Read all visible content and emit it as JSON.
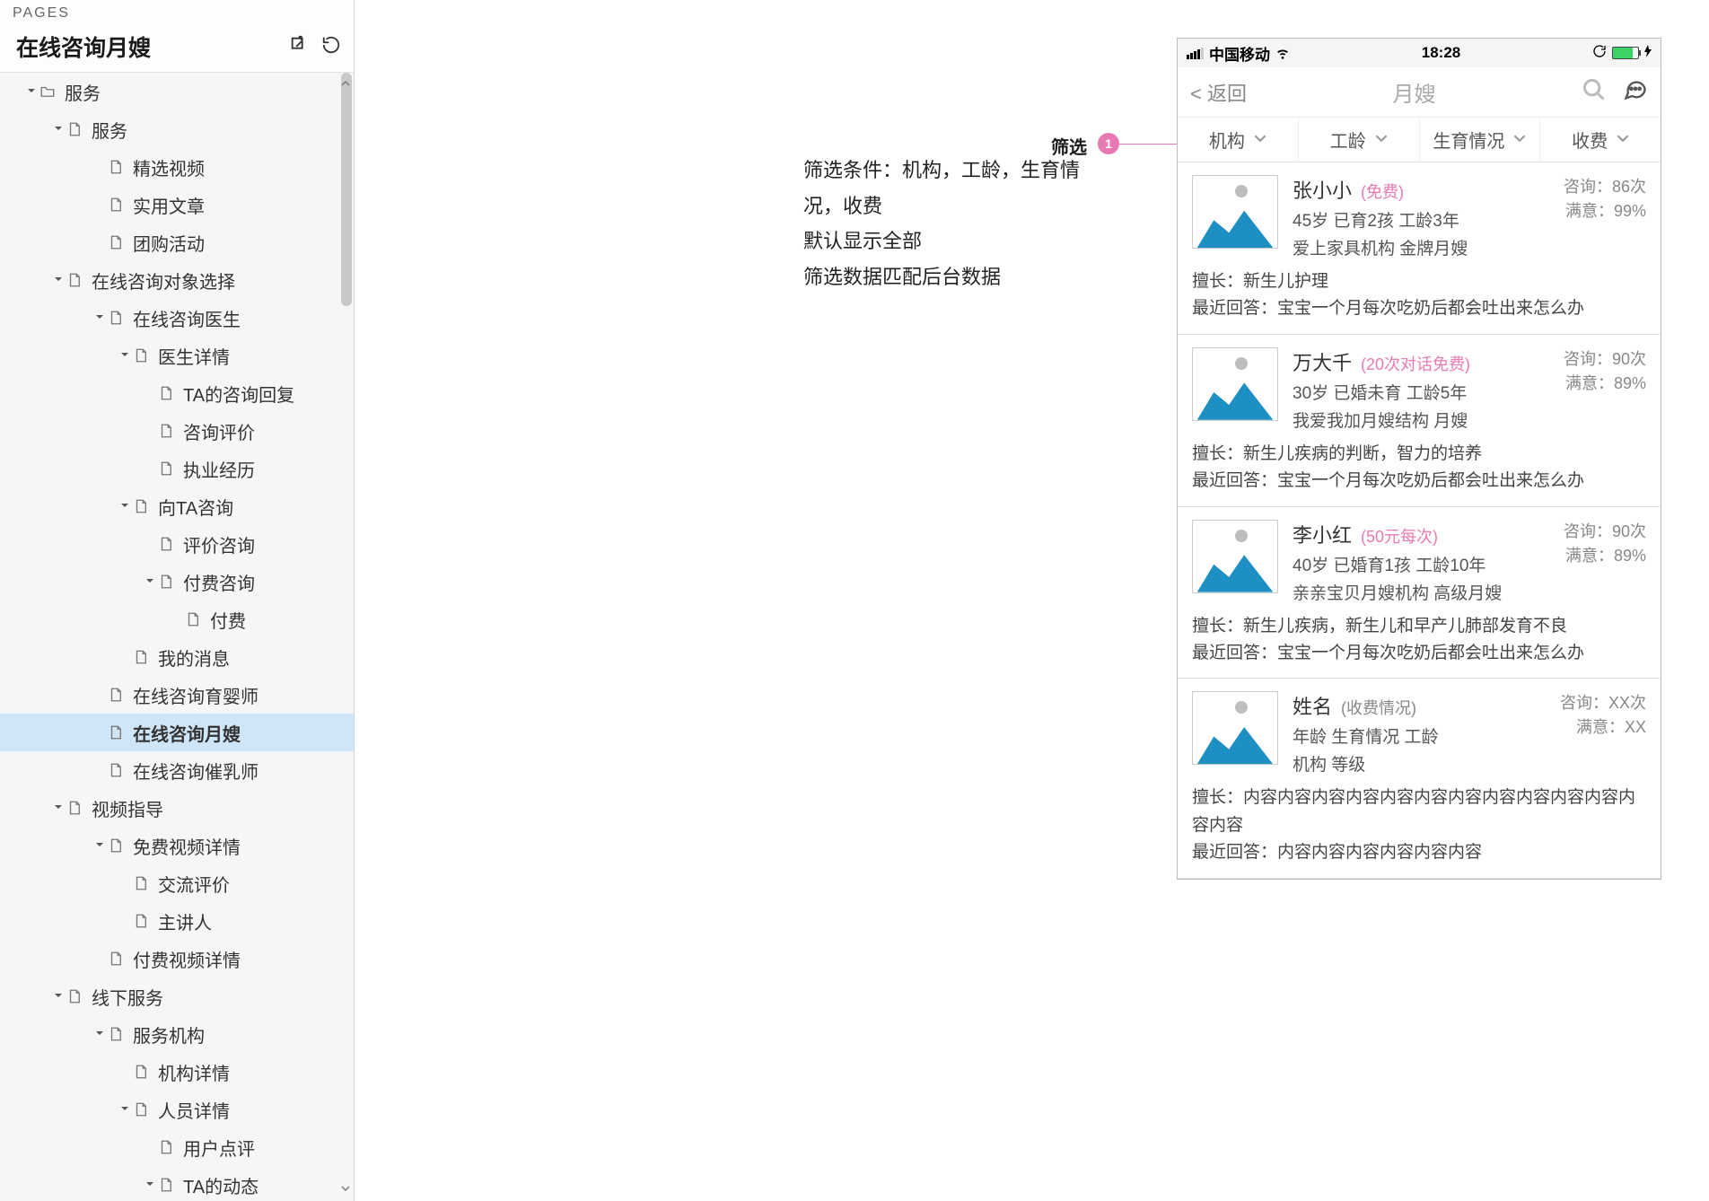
{
  "sidebar": {
    "section_label": "PAGES",
    "title": "在线咨询月嫂",
    "tree": [
      {
        "lv": 0,
        "arrow": true,
        "type": "folder",
        "label": "服务"
      },
      {
        "lv": 1,
        "arrow": true,
        "type": "doc",
        "label": "服务"
      },
      {
        "lv": 2,
        "arrow": false,
        "type": "doc",
        "label": "精选视频"
      },
      {
        "lv": 2,
        "arrow": false,
        "type": "doc",
        "label": "实用文章"
      },
      {
        "lv": 2,
        "arrow": false,
        "type": "doc",
        "label": "团购活动"
      },
      {
        "lv": 1,
        "arrow": true,
        "type": "doc",
        "label": "在线咨询对象选择"
      },
      {
        "lv": 2,
        "arrow": true,
        "type": "doc",
        "label": "在线咨询医生"
      },
      {
        "lv": 3,
        "arrow": true,
        "type": "doc",
        "label": "医生详情"
      },
      {
        "lv": 4,
        "arrow": false,
        "type": "doc",
        "label": "TA的咨询回复"
      },
      {
        "lv": 4,
        "arrow": false,
        "type": "doc",
        "label": "咨询评价"
      },
      {
        "lv": 4,
        "arrow": false,
        "type": "doc",
        "label": "执业经历"
      },
      {
        "lv": 3,
        "arrow": true,
        "type": "doc",
        "label": "向TA咨询"
      },
      {
        "lv": 4,
        "arrow": false,
        "type": "doc",
        "label": "评价咨询"
      },
      {
        "lv": 4,
        "arrow": true,
        "type": "doc",
        "label": "付费咨询"
      },
      {
        "lv": 5,
        "arrow": false,
        "type": "doc",
        "label": "付费"
      },
      {
        "lv": 3,
        "arrow": false,
        "type": "doc",
        "label": "我的消息"
      },
      {
        "lv": 2,
        "arrow": false,
        "type": "doc",
        "label": "在线咨询育婴师"
      },
      {
        "lv": 2,
        "arrow": false,
        "type": "doc",
        "label": "在线咨询月嫂",
        "selected": true
      },
      {
        "lv": 2,
        "arrow": false,
        "type": "doc",
        "label": "在线咨询催乳师"
      },
      {
        "lv": 1,
        "arrow": true,
        "type": "doc",
        "label": "视频指导"
      },
      {
        "lv": 2,
        "arrow": true,
        "type": "doc",
        "label": "免费视频详情"
      },
      {
        "lv": 3,
        "arrow": false,
        "type": "doc",
        "label": "交流评价"
      },
      {
        "lv": 3,
        "arrow": false,
        "type": "doc",
        "label": "主讲人"
      },
      {
        "lv": 2,
        "arrow": false,
        "type": "doc",
        "label": "付费视频详情"
      },
      {
        "lv": 1,
        "arrow": true,
        "type": "doc",
        "label": "线下服务"
      },
      {
        "lv": 2,
        "arrow": true,
        "type": "doc",
        "label": "服务机构"
      },
      {
        "lv": 3,
        "arrow": false,
        "type": "doc",
        "label": "机构详情"
      },
      {
        "lv": 3,
        "arrow": true,
        "type": "doc",
        "label": "人员详情"
      },
      {
        "lv": 4,
        "arrow": false,
        "type": "doc",
        "label": "用户点评"
      },
      {
        "lv": 4,
        "arrow": true,
        "type": "doc",
        "label": "TA的动态"
      }
    ]
  },
  "annotation": {
    "filter_label": "筛选",
    "marker": "1",
    "line1": "筛选条件：机构，工龄，生育情况，收费",
    "line2": "默认显示全部",
    "line3": "筛选数据匹配后台数据"
  },
  "phone": {
    "status": {
      "carrier": "中国移动",
      "time": "18:28"
    },
    "nav": {
      "back": "< 返回",
      "title": "月嫂"
    },
    "filters": [
      "机构",
      "工龄",
      "生育情况",
      "收费"
    ],
    "cards": [
      {
        "name": "张小小",
        "tag": "(免费)",
        "meta1": "45岁  已育2孩   工龄3年",
        "meta2": "爱上家具机构 金牌月嫂",
        "consult": "咨询：86次",
        "satisfy": "满意：99%",
        "skill": "擅长：新生儿护理",
        "recent": "最近回答：宝宝一个月每次吃奶后都会吐出来怎么办"
      },
      {
        "name": "万大千",
        "tag": "(20次对话免费)",
        "meta1": "30岁  已婚未育   工龄5年",
        "meta2": "我爱我加月嫂结构  月嫂",
        "consult": "咨询：90次",
        "satisfy": "满意：89%",
        "skill": "擅长：新生儿疾病的判断，智力的培养",
        "recent": "最近回答：宝宝一个月每次吃奶后都会吐出来怎么办"
      },
      {
        "name": "李小红",
        "tag": "(50元每次)",
        "meta1": "40岁 已婚育1孩   工龄10年",
        "meta2": "亲亲宝贝月嫂机构  高级月嫂",
        "consult": "咨询：90次",
        "satisfy": "满意：89%",
        "skill": "擅长：新生儿疾病，新生儿和早产儿肺部发育不良",
        "recent": "最近回答：宝宝一个月每次吃奶后都会吐出来怎么办"
      },
      {
        "name": "姓名",
        "tag": "(收费情况)",
        "tag_gray": true,
        "meta1": "年龄  生育情况  工龄",
        "meta2": "机构 等级",
        "consult": "咨询：XX次",
        "satisfy": "满意：XX",
        "skill": "擅长：内容内容内容内容内容内容内容内容内容内容内容内容内容",
        "recent": "最近回答：内容内容内容内容内容内容"
      }
    ]
  }
}
